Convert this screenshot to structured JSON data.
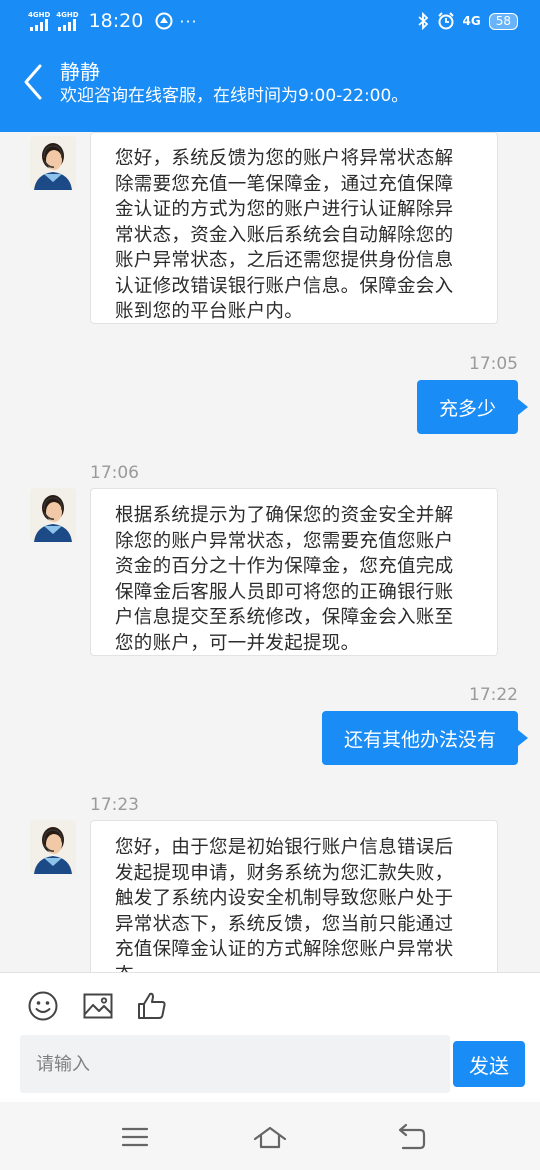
{
  "status_bar": {
    "network1": "4GHD",
    "network2": "4GHD",
    "time": "18:20",
    "network_right": "4G",
    "battery": "58"
  },
  "header": {
    "title": "静静",
    "subtitle": "欢迎咨询在线客服，在线时间为9:00-22:00。"
  },
  "messages": [
    {
      "from": "agent",
      "lines": [
        "您好，系统反馈为您的账户将异常状态解",
        "除需要您充值一笔保障金，通过充值保障",
        "金认证的方式为您的账户进行认证解除异",
        "常状态，资金入账后系统会自动解除您的",
        "账户异常状态，之后还需您提供身份信息",
        "认证修改错误银行账户信息。保障金会入",
        "账到您的平台账户内。"
      ]
    },
    {
      "from": "user",
      "time": "17:05",
      "text": "充多少"
    },
    {
      "from": "agent",
      "time": "17:06",
      "lines": [
        "根据系统提示为了确保您的资金安全并解",
        "除您的账户异常状态，您需要充值您账户",
        "资金的百分之十作为保障金，您充值完成",
        "保障金后客服人员即可将您的正确银行账",
        "户信息提交至系统修改，保障金会入账至",
        "您的账户，可一并发起提现。"
      ]
    },
    {
      "from": "user",
      "time": "17:22",
      "text": "还有其他办法没有"
    },
    {
      "from": "agent",
      "time": "17:23",
      "lines": [
        "您好，由于您是初始银行账户信息错误后",
        "发起提现申请，财务系统为您汇款失败，",
        "触发了系统内设安全机制导致您账户处于",
        "异常状态下，系统反馈，您当前只能通过",
        "充值保障金认证的方式解除您账户异常状",
        "态。"
      ]
    }
  ],
  "input": {
    "placeholder": "请输入",
    "send_label": "发送"
  },
  "colors": {
    "accent": "#1a8cf5",
    "background": "#f4f4f4"
  },
  "icons": [
    "back-arrow-icon",
    "emoji-icon",
    "image-icon",
    "thumbs-up-icon",
    "menu-icon",
    "home-icon",
    "back-icon"
  ]
}
